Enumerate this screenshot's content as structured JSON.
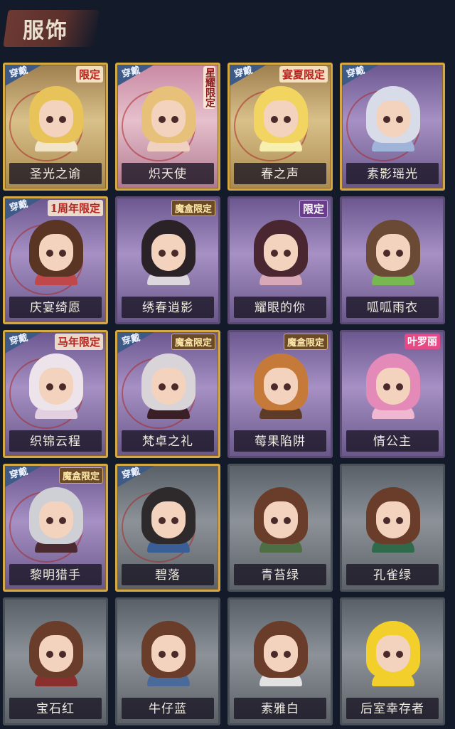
{
  "header": {
    "title": "服饰"
  },
  "cards": [
    {
      "name": "圣光之谕",
      "equipped": true,
      "badge": "限定",
      "badge_style": "red",
      "frame": "gold",
      "bg": "gold",
      "hair": "#e8c35a",
      "outfit": "#f2e4c8"
    },
    {
      "name": "炽天使",
      "equipped": true,
      "badge": "星耀限定",
      "badge_style": "vert",
      "frame": "gold",
      "bg": "pink",
      "hair": "#e7c07a",
      "outfit": "#f0d0c0"
    },
    {
      "name": "春之声",
      "equipped": true,
      "badge": "宴夏限定",
      "badge_style": "red",
      "frame": "gold",
      "bg": "gold",
      "hair": "#f2d460",
      "outfit": "#f7efb0"
    },
    {
      "name": "素影瑶光",
      "equipped": true,
      "badge": "",
      "badge_style": "",
      "frame": "gold",
      "bg": "purple",
      "hair": "#d8dce8",
      "outfit": "#9fb4d8"
    },
    {
      "name": "庆宴绮愿",
      "equipped": true,
      "badge": "1周年限定",
      "badge_style": "red",
      "frame": "gold",
      "bg": "purple",
      "hair": "#5a3524",
      "outfit": "#c0484a"
    },
    {
      "name": "绣春逍影",
      "equipped": false,
      "badge": "魔盒限定",
      "badge_style": "mohe",
      "frame": "purple",
      "bg": "purple",
      "hair": "#2a2226",
      "outfit": "#dcd6de"
    },
    {
      "name": "耀眼的你",
      "equipped": false,
      "badge": "限定",
      "badge_style": "white",
      "frame": "purple",
      "bg": "purple",
      "hair": "#4a2630",
      "outfit": "#d8a8b8"
    },
    {
      "name": "呱呱雨衣",
      "equipped": false,
      "badge": "",
      "badge_style": "",
      "frame": "purple",
      "bg": "purple",
      "hair": "#6a4a34",
      "outfit": "#78b850"
    },
    {
      "name": "织锦云程",
      "equipped": true,
      "badge": "马年限定",
      "badge_style": "red",
      "frame": "gold",
      "bg": "purple",
      "hair": "#ece4ea",
      "outfit": "#e2d0e0"
    },
    {
      "name": "梵卓之礼",
      "equipped": true,
      "badge": "魔盒限定",
      "badge_style": "mohe",
      "frame": "gold",
      "bg": "purple",
      "hair": "#d8d4d8",
      "outfit": "#3a2026"
    },
    {
      "name": "莓果陷阱",
      "equipped": false,
      "badge": "魔盒限定",
      "badge_style": "mohe",
      "frame": "purple",
      "bg": "purple",
      "hair": "#c67a3a",
      "outfit": "#5e3a28"
    },
    {
      "name": "情公主",
      "equipped": false,
      "badge": "叶罗丽",
      "badge_style": "pink",
      "frame": "purple",
      "bg": "purple",
      "hair": "#e48ab8",
      "outfit": "#f0b8d0"
    },
    {
      "name": "黎明猎手",
      "equipped": true,
      "badge": "魔盒限定",
      "badge_style": "mohe",
      "frame": "gold",
      "bg": "purple",
      "hair": "#cfcfd6",
      "outfit": "#4a2a30"
    },
    {
      "name": "碧落",
      "equipped": true,
      "badge": "",
      "badge_style": "",
      "frame": "gold",
      "bg": "gray",
      "hair": "#2e2a2c",
      "outfit": "#3a5e96"
    },
    {
      "name": "青苔绿",
      "equipped": false,
      "badge": "",
      "badge_style": "",
      "frame": "gray",
      "bg": "gray",
      "hair": "#6a3c2a",
      "outfit": "#4e6e44"
    },
    {
      "name": "孔雀绿",
      "equipped": false,
      "badge": "",
      "badge_style": "",
      "frame": "gray",
      "bg": "gray",
      "hair": "#6a3c2a",
      "outfit": "#2f6a4a"
    },
    {
      "name": "宝石红",
      "equipped": false,
      "badge": "",
      "badge_style": "",
      "frame": "gray",
      "bg": "gray",
      "hair": "#6a3c2a",
      "outfit": "#8a2e2e"
    },
    {
      "name": "牛仔蓝",
      "equipped": false,
      "badge": "",
      "badge_style": "",
      "frame": "gray",
      "bg": "gray",
      "hair": "#6a3c2a",
      "outfit": "#4a6a9a"
    },
    {
      "name": "素雅白",
      "equipped": false,
      "badge": "",
      "badge_style": "",
      "frame": "gray",
      "bg": "gray",
      "hair": "#6a3c2a",
      "outfit": "#e2e2e2"
    },
    {
      "name": "后室幸存者",
      "equipped": false,
      "badge": "",
      "badge_style": "",
      "frame": "gray",
      "bg": "gray",
      "hair": "#f2cf2a",
      "outfit": "#f2cf2a"
    }
  ],
  "equip_label": "穿戴"
}
